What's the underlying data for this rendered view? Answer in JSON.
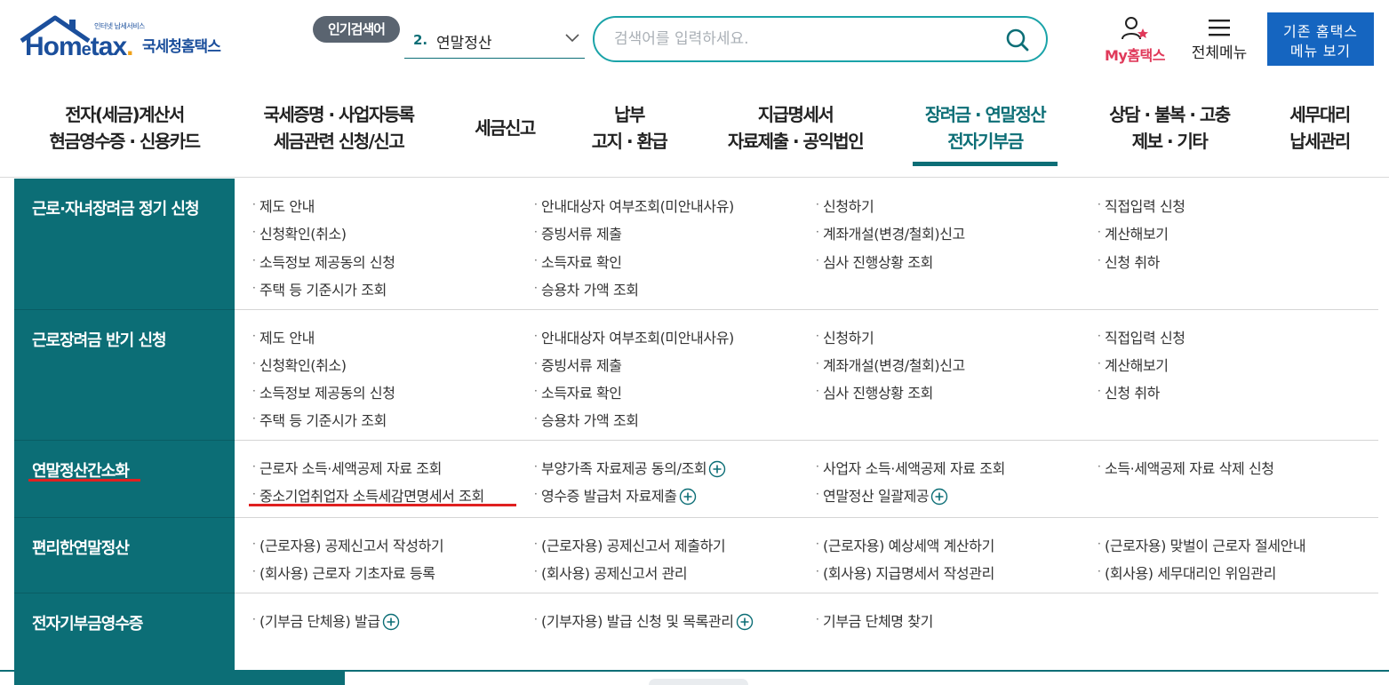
{
  "logo": {
    "small_text": "인터넷 납세서비스",
    "main_text": "Hom",
    "e_text": "e",
    "tax_text": "tax",
    "dot_text": ".",
    "kr_text": "국세청홈택스"
  },
  "popular_search": {
    "badge": "인기검색어",
    "rank": "2.",
    "term": "연말정산"
  },
  "search": {
    "placeholder": "검색어를 입력하세요."
  },
  "header_links": {
    "my_hometax": "My홈택스",
    "all_menu": "전체메뉴",
    "classic_button": "기존 홈택스\n메뉴 보기"
  },
  "gnb": [
    {
      "label": "전자(세금)계산서\n현금영수증 · 신용카드"
    },
    {
      "label": "국세증명 · 사업자등록\n세금관련 신청/신고"
    },
    {
      "label": "세금신고"
    },
    {
      "label": "납부\n고지 · 환급"
    },
    {
      "label": "지급명세서\n자료제출 · 공익법인"
    },
    {
      "label": "장려금 · 연말정산\n전자기부금"
    },
    {
      "label": "상담 · 불복 · 고충\n제보 · 기타"
    },
    {
      "label": "세무대리\n납세관리"
    }
  ],
  "sections": [
    {
      "title": "근로·자녀장려금 정기 신청",
      "links": [
        [
          "제도 안내",
          "안내대상자 여부조회(미안내사유)",
          "신청하기",
          "직접입력 신청"
        ],
        [
          "신청확인(취소)",
          "증빙서류 제출",
          "계좌개설(변경/철회)신고",
          "계산해보기"
        ],
        [
          "소득정보 제공동의 신청",
          "소득자료 확인",
          "심사 진행상황 조회",
          "신청 취하"
        ],
        [
          "주택 등 기준시가 조회",
          "승용차 가액 조회",
          "",
          ""
        ]
      ]
    },
    {
      "title": "근로장려금 반기 신청",
      "links": [
        [
          "제도 안내",
          "안내대상자 여부조회(미안내사유)",
          "신청하기",
          "직접입력 신청"
        ],
        [
          "신청확인(취소)",
          "증빙서류 제출",
          "계좌개설(변경/철회)신고",
          "계산해보기"
        ],
        [
          "소득정보 제공동의 신청",
          "소득자료 확인",
          "심사 진행상황 조회",
          "신청 취하"
        ],
        [
          "주택 등 기준시가 조회",
          "승용차 가액 조회",
          "",
          ""
        ]
      ]
    },
    {
      "title": "연말정산간소화",
      "links": [
        [
          "근로자 소득·세액공제 자료 조회",
          "부양가족 자료제공 동의/조회",
          "사업자 소득·세액공제 자료 조회",
          "소득·세액공제 자료 삭제 신청"
        ],
        [
          "중소기업취업자 소득세감면명세서 조회",
          "영수증 발급처 자료제출",
          "연말정산 일괄제공",
          ""
        ]
      ]
    },
    {
      "title": "편리한연말정산",
      "links": [
        [
          "(근로자용) 공제신고서 작성하기",
          "(근로자용) 공제신고서 제출하기",
          "(근로자용) 예상세액 계산하기",
          "(근로자용) 맞벌이 근로자 절세안내"
        ],
        [
          "(회사용) 근로자 기초자료 등록",
          "(회사용) 공제신고서 관리",
          "(회사용) 지급명세서 작성관리",
          "(회사용) 세무대리인 위임관리"
        ]
      ]
    },
    {
      "title": "전자기부금영수증",
      "links": [
        [
          "(기부금 단체용) 발급",
          "(기부자용) 발급 신청 및 목록관리",
          "기부금 단체명 찾기",
          ""
        ]
      ]
    }
  ],
  "colors": {
    "teal": "#0c6e76",
    "accent_red": "#e02020",
    "brand_blue": "#1b4f9c",
    "pink": "#e0395a"
  }
}
